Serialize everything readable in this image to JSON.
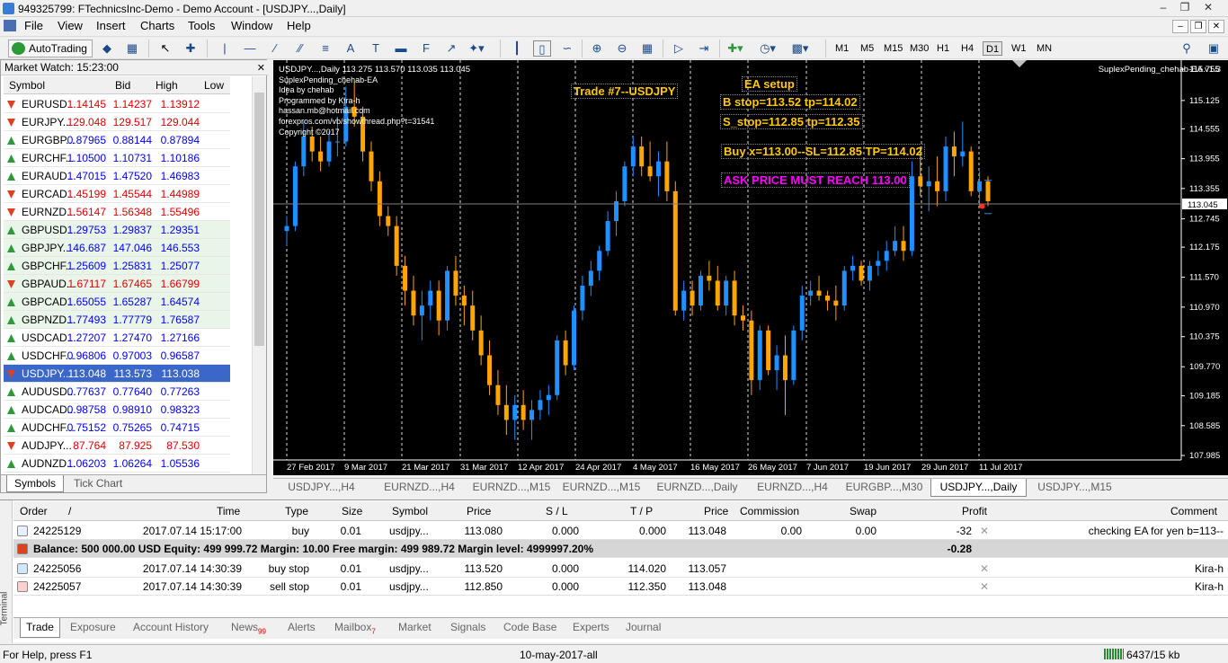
{
  "window": {
    "title": "949325799: FTechnicsInc-Demo - Demo Account - [USDJPY...,Daily]"
  },
  "menu": [
    "File",
    "View",
    "Insert",
    "Charts",
    "Tools",
    "Window",
    "Help"
  ],
  "toolbar": {
    "autotrading": "AutoTrading",
    "timeframes": [
      "M1",
      "M5",
      "M15",
      "M30",
      "H1",
      "H4",
      "D1",
      "W1",
      "MN"
    ],
    "active_tf": "D1"
  },
  "market_watch": {
    "title": "Market Watch: 15:23:00",
    "columns": [
      "Symbol",
      "Bid",
      "High",
      "Low"
    ],
    "rows": [
      {
        "symbol": "EURUSD...",
        "bid": "1.14145",
        "high": "1.14237",
        "low": "1.13912",
        "dir": "dn"
      },
      {
        "symbol": "EURJPY...",
        "bid": "129.048",
        "high": "129.517",
        "low": "129.044",
        "dir": "dn"
      },
      {
        "symbol": "EURGBP...",
        "bid": "0.87965",
        "high": "0.88144",
        "low": "0.87894",
        "dir": "up"
      },
      {
        "symbol": "EURCHF...",
        "bid": "1.10500",
        "high": "1.10731",
        "low": "1.10186",
        "dir": "up"
      },
      {
        "symbol": "EURAUD...",
        "bid": "1.47015",
        "high": "1.47520",
        "low": "1.46983",
        "dir": "up"
      },
      {
        "symbol": "EURCAD...",
        "bid": "1.45199",
        "high": "1.45544",
        "low": "1.44989",
        "dir": "dn"
      },
      {
        "symbol": "EURNZD...",
        "bid": "1.56147",
        "high": "1.56348",
        "low": "1.55496",
        "dir": "dn"
      },
      {
        "symbol": "GBPUSD...",
        "bid": "1.29753",
        "high": "1.29837",
        "low": "1.29351",
        "dir": "up"
      },
      {
        "symbol": "GBPJPY...",
        "bid": "146.687",
        "high": "147.046",
        "low": "146.553",
        "dir": "up"
      },
      {
        "symbol": "GBPCHF...",
        "bid": "1.25609",
        "high": "1.25831",
        "low": "1.25077",
        "dir": "up"
      },
      {
        "symbol": "GBPAUD...",
        "bid": "1.67117",
        "high": "1.67465",
        "low": "1.66799",
        "dir": "dn"
      },
      {
        "symbol": "GBPCAD...",
        "bid": "1.65055",
        "high": "1.65287",
        "low": "1.64574",
        "dir": "up"
      },
      {
        "symbol": "GBPNZD...",
        "bid": "1.77493",
        "high": "1.77779",
        "low": "1.76587",
        "dir": "up"
      },
      {
        "symbol": "USDCAD...",
        "bid": "1.27207",
        "high": "1.27470",
        "low": "1.27166",
        "dir": "up"
      },
      {
        "symbol": "USDCHF...",
        "bid": "0.96806",
        "high": "0.97003",
        "low": "0.96587",
        "dir": "up"
      },
      {
        "symbol": "USDJPY...",
        "bid": "113.048",
        "high": "113.573",
        "low": "113.038",
        "dir": "dn",
        "selected": true
      },
      {
        "symbol": "AUDUSD...",
        "bid": "0.77637",
        "high": "0.77640",
        "low": "0.77263",
        "dir": "up"
      },
      {
        "symbol": "AUDCAD...",
        "bid": "0.98758",
        "high": "0.98910",
        "low": "0.98323",
        "dir": "up"
      },
      {
        "symbol": "AUDCHF...",
        "bid": "0.75152",
        "high": "0.75265",
        "low": "0.74715",
        "dir": "up"
      },
      {
        "symbol": "AUDJPY...",
        "bid": "87.764",
        "high": "87.925",
        "low": "87.530",
        "dir": "dn"
      },
      {
        "symbol": "AUDNZD...",
        "bid": "1.06203",
        "high": "1.06264",
        "low": "1.05536",
        "dir": "up"
      }
    ],
    "tabs": [
      "Symbols",
      "Tick Chart"
    ]
  },
  "chart": {
    "header": "USDJPY...,Daily  113.275 113.570 113.035 113.045",
    "info": [
      "SuplexPending_chehab-EA",
      "Idea by chehab",
      "Programmed by Kira-h",
      "hassan.mb@hotmail.com",
      "forexpros.com/vb/showthread.php?t=31541",
      "Copyright ©2017"
    ],
    "ea_name": "SuplexPending_chehab-EA v1.3",
    "labels": {
      "trade": "Trade #7--USDJPY",
      "setup": "EA setup",
      "bstop": "B stop=113.52   tp=114.02",
      "sstop": "S_stop=112.85   tp=112.35",
      "buy": "Buy x=113.00--SL=112.85  TP=114.02",
      "ask": "ASK PRICE MUST REACH 113.00"
    },
    "current_price": "113.045"
  },
  "chart_data": {
    "type": "candlestick",
    "y_ticks": [
      "115.755",
      "115.125",
      "114.555",
      "113.955",
      "113.355",
      "112.745",
      "112.175",
      "111.570",
      "110.970",
      "110.375",
      "109.770",
      "109.185",
      "108.585",
      "107.985"
    ],
    "ylim": [
      107.985,
      115.755
    ],
    "x_ticks": [
      "27 Feb 2017",
      "9 Mar 2017",
      "21 Mar 2017",
      "31 Mar 2017",
      "12 Apr 2017",
      "24 Apr 2017",
      "4 May 2017",
      "16 May 2017",
      "26 May 2017",
      "7 Jun 2017",
      "19 Jun 2017",
      "29 Jun 2017",
      "11 Jul 2017"
    ],
    "candles": [
      [
        112.5,
        112.8,
        112.2,
        112.6
      ],
      [
        112.6,
        113.9,
        112.5,
        113.8
      ],
      [
        113.8,
        114.7,
        113.6,
        114.4
      ],
      [
        114.4,
        114.6,
        113.9,
        114.1
      ],
      [
        114.1,
        114.4,
        113.7,
        113.9
      ],
      [
        113.9,
        114.5,
        113.8,
        114.3
      ],
      [
        114.3,
        114.8,
        114.0,
        114.3
      ],
      [
        114.3,
        115.4,
        114.2,
        115.0
      ],
      [
        115.0,
        115.5,
        114.6,
        114.8
      ],
      [
        114.8,
        115.0,
        113.9,
        114.1
      ],
      [
        114.1,
        114.3,
        113.3,
        113.5
      ],
      [
        113.5,
        113.7,
        112.6,
        112.8
      ],
      [
        112.8,
        113.0,
        112.4,
        112.6
      ],
      [
        112.6,
        112.8,
        111.6,
        111.8
      ],
      [
        111.8,
        112.0,
        111.0,
        111.3
      ],
      [
        111.3,
        111.6,
        110.6,
        110.8
      ],
      [
        110.8,
        111.3,
        110.3,
        111.0
      ],
      [
        111.0,
        111.5,
        110.7,
        111.3
      ],
      [
        111.3,
        111.5,
        110.4,
        110.7
      ],
      [
        110.7,
        111.8,
        110.5,
        111.7
      ],
      [
        111.7,
        112.0,
        111.0,
        111.2
      ],
      [
        111.2,
        111.4,
        110.6,
        111.0
      ],
      [
        111.0,
        111.3,
        110.3,
        110.5
      ],
      [
        110.5,
        110.8,
        109.8,
        110.0
      ],
      [
        110.0,
        110.3,
        109.2,
        109.4
      ],
      [
        109.4,
        109.7,
        108.8,
        109.0
      ],
      [
        109.0,
        109.4,
        108.4,
        108.7
      ],
      [
        108.7,
        109.2,
        108.3,
        109.0
      ],
      [
        109.0,
        109.3,
        108.5,
        108.7
      ],
      [
        108.7,
        109.1,
        108.3,
        108.9
      ],
      [
        108.9,
        109.3,
        108.7,
        109.1
      ],
      [
        109.1,
        109.4,
        108.8,
        109.2
      ],
      [
        109.2,
        110.4,
        109.1,
        110.3
      ],
      [
        110.3,
        110.5,
        109.6,
        109.8
      ],
      [
        109.8,
        111.0,
        109.7,
        110.9
      ],
      [
        110.9,
        111.6,
        110.7,
        111.4
      ],
      [
        111.4,
        111.9,
        111.2,
        111.7
      ],
      [
        111.7,
        112.2,
        111.5,
        112.1
      ],
      [
        112.1,
        112.9,
        112.0,
        112.7
      ],
      [
        112.7,
        113.3,
        112.4,
        113.1
      ],
      [
        113.1,
        113.9,
        113.0,
        113.8
      ],
      [
        113.8,
        114.4,
        113.6,
        114.2
      ],
      [
        114.2,
        114.4,
        113.6,
        113.8
      ],
      [
        113.8,
        114.3,
        113.5,
        113.6
      ],
      [
        113.6,
        114.1,
        113.2,
        113.9
      ],
      [
        113.9,
        114.3,
        113.1,
        113.3
      ],
      [
        113.3,
        113.5,
        110.8,
        110.9
      ],
      [
        110.9,
        111.5,
        110.7,
        111.3
      ],
      [
        111.3,
        111.5,
        110.8,
        111.0
      ],
      [
        111.0,
        111.7,
        110.9,
        111.6
      ],
      [
        111.6,
        111.9,
        111.3,
        111.5
      ],
      [
        111.5,
        111.8,
        110.9,
        111.0
      ],
      [
        111.0,
        111.6,
        110.8,
        111.5
      ],
      [
        111.5,
        111.7,
        110.6,
        110.8
      ],
      [
        110.8,
        111.0,
        110.5,
        110.7
      ],
      [
        110.7,
        110.9,
        109.2,
        109.5
      ],
      [
        109.5,
        110.6,
        109.3,
        110.5
      ],
      [
        110.5,
        110.6,
        109.6,
        109.7
      ],
      [
        109.7,
        110.2,
        109.3,
        110.0
      ],
      [
        110.0,
        110.4,
        108.8,
        109.5
      ],
      [
        109.5,
        110.6,
        109.4,
        110.5
      ],
      [
        110.5,
        111.4,
        110.3,
        111.2
      ],
      [
        111.2,
        111.5,
        111.0,
        111.3
      ],
      [
        111.3,
        111.6,
        111.1,
        111.2
      ],
      [
        111.2,
        111.3,
        110.9,
        111.1
      ],
      [
        111.1,
        111.4,
        110.7,
        111.0
      ],
      [
        111.0,
        111.8,
        110.9,
        111.7
      ],
      [
        111.7,
        112.0,
        111.5,
        111.8
      ],
      [
        111.8,
        111.9,
        111.4,
        111.5
      ],
      [
        111.5,
        111.9,
        111.3,
        111.8
      ],
      [
        111.8,
        112.1,
        111.6,
        111.9
      ],
      [
        111.9,
        112.3,
        111.7,
        112.1
      ],
      [
        112.1,
        112.6,
        112.0,
        112.3
      ],
      [
        112.3,
        112.6,
        111.9,
        112.1
      ],
      [
        112.1,
        113.9,
        112.0,
        113.6
      ],
      [
        113.6,
        114.2,
        113.2,
        113.4
      ],
      [
        113.4,
        113.8,
        112.9,
        113.5
      ],
      [
        113.5,
        114.0,
        113.0,
        113.3
      ],
      [
        113.3,
        114.4,
        113.1,
        114.2
      ],
      [
        114.2,
        114.5,
        113.6,
        114.0
      ],
      [
        114.0,
        114.7,
        113.8,
        114.1
      ],
      [
        114.1,
        114.2,
        113.2,
        113.3
      ],
      [
        113.3,
        113.7,
        113.0,
        113.5
      ],
      [
        113.5,
        113.6,
        113.0,
        113.1
      ]
    ]
  },
  "chart_tabs": [
    "USDJPY...,H4",
    "EURNZD...,H4",
    "EURNZD...,M15",
    "EURNZD...,M15",
    "EURNZD...,Daily",
    "EURNZD...,H4",
    "EURGBP...,M30",
    "USDJPY...,Daily",
    "USDJPY...,M15"
  ],
  "active_chart_tab": 7,
  "terminal": {
    "side_label": "Terminal",
    "columns": [
      "Order",
      "/",
      "Time",
      "Type",
      "Size",
      "Symbol",
      "Price",
      "S / L",
      "T / P",
      "Price",
      "Commission",
      "Swap",
      "Profit",
      "Comment"
    ],
    "rows": [
      {
        "order": "24225129",
        "time": "2017.07.14 15:17:00",
        "type": "buy",
        "size": "0.01",
        "symbol": "usdjpy...",
        "price": "113.080",
        "sl": "0.000",
        "tp": "0.000",
        "cur": "113.048",
        "commission": "0.00",
        "swap": "0.00",
        "profit": "-32",
        "comment": "checking EA for yen b=113--"
      },
      {
        "order": "24225056",
        "time": "2017.07.14 14:30:39",
        "type": "buy stop",
        "size": "0.01",
        "symbol": "usdjpy...",
        "price": "113.520",
        "sl": "0.000",
        "tp": "114.020",
        "cur": "113.057",
        "commission": "",
        "swap": "",
        "profit": "",
        "comment": "Kira-h"
      },
      {
        "order": "24225057",
        "time": "2017.07.14 14:30:39",
        "type": "sell stop",
        "size": "0.01",
        "symbol": "usdjpy...",
        "price": "112.850",
        "sl": "0.000",
        "tp": "112.350",
        "cur": "113.048",
        "commission": "",
        "swap": "",
        "profit": "",
        "comment": "Kira-h"
      }
    ],
    "balance": "Balance: 500 000.00 USD  Equity: 499 999.72  Margin: 10.00  Free margin: 499 989.72  Margin level: 4999997.20%",
    "balance_profit": "-0.28",
    "tabs": [
      {
        "label": "Trade"
      },
      {
        "label": "Exposure"
      },
      {
        "label": "Account History"
      },
      {
        "label": "News",
        "badge": "99"
      },
      {
        "label": "Alerts"
      },
      {
        "label": "Mailbox",
        "badge": "7"
      },
      {
        "label": "Market"
      },
      {
        "label": "Signals"
      },
      {
        "label": "Code Base"
      },
      {
        "label": "Experts"
      },
      {
        "label": "Journal"
      }
    ]
  },
  "status": {
    "help": "For Help, press F1",
    "profile": "10-may-2017-all",
    "traffic": "6437/15 kb"
  },
  "colors": {
    "bull": "#1e90ff",
    "bear": "#ffa500",
    "price_line": "#7f7f7f",
    "label_text": "#ffc800",
    "ask_text": "#ff00ff"
  }
}
